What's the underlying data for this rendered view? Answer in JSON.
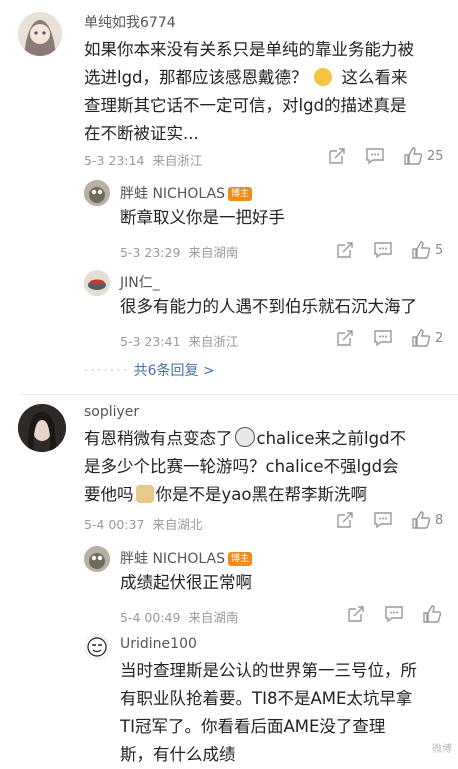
{
  "comments": [
    {
      "username": "单纯如我6774",
      "lines": [
        "如果你本来没有关系只是单纯的靠业务能力被",
        "选进lgd，那都应该感恩戴德？",
        "这么看来",
        "查理斯其它话不一定可信，对lgd的描述真是",
        "在不断被证实..."
      ],
      "time": "5-3 23:14",
      "location": "来自浙江",
      "likes": "25"
    },
    {
      "username": "胖蛙 NICHOLAS",
      "badge": "博主",
      "text": "断章取义你是一把好手",
      "time": "5-3 23:29",
      "location": "来自湖南",
      "likes": "5"
    },
    {
      "username": "JIN仁_",
      "text": "很多有能力的人遇不到伯乐就石沉大海了",
      "time": "5-3 23:41",
      "location": "来自浙江",
      "likes": "2"
    },
    {
      "more_replies": "共6条回复 >"
    },
    {
      "username": "sopliyer",
      "lines": [
        "有恩稍微有点变态了",
        "chalice来之前lgd不",
        "是多少个比赛一轮游吗？chalice不强lgd会",
        "要他吗",
        "你是不是yao黑在帮李斯洗啊"
      ],
      "time": "5-4 00:37",
      "location": "来自湖北",
      "likes": "8"
    },
    {
      "username": "胖蛙 NICHOLAS",
      "badge": "博主",
      "text": "成绩起伏很正常啊",
      "time": "5-4 00:49",
      "location": "来自湖南",
      "likes": ""
    },
    {
      "username": "Uridine100",
      "lines": [
        "当时查理斯是公认的世界第一三号位，所",
        "有职业队抢着要。TI8不是AME太坑早拿",
        "TI冠军了。你看看后面AME没了查理",
        "斯，有什么成绩"
      ]
    }
  ],
  "colors": {
    "badge": "#f28a1c",
    "link": "#4a6fa5",
    "meta": "#9a9a9a"
  },
  "icons": [
    "share-icon",
    "comment-icon",
    "like-icon"
  ],
  "watermark": "微博"
}
